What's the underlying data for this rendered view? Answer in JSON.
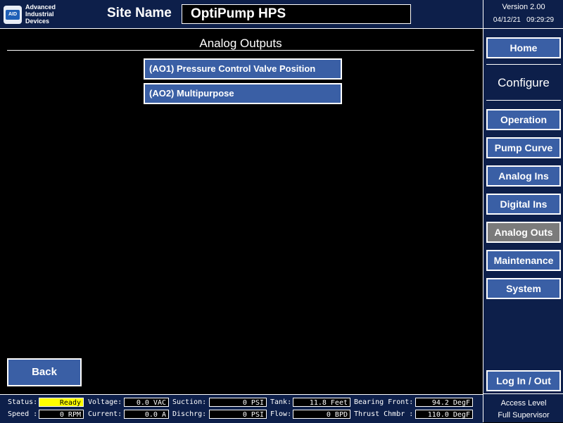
{
  "header": {
    "logo_badge": "AID",
    "logo_line1": "Advanced",
    "logo_line2": "Industrial",
    "logo_line3": "Devices",
    "site_label": "Site Name",
    "site_name": "OptiPump HPS"
  },
  "sidebar": {
    "version": "Version 2.00",
    "date": "04/12/21",
    "time": "09:29:29",
    "home": "Home",
    "configure": "Configure",
    "items": [
      {
        "label": "Operation"
      },
      {
        "label": "Pump Curve"
      },
      {
        "label": "Analog Ins"
      },
      {
        "label": "Digital Ins"
      },
      {
        "label": "Analog Outs",
        "active": true
      },
      {
        "label": "Maintenance"
      },
      {
        "label": "System"
      }
    ],
    "login": "Log In / Out",
    "access_label": "Access Level",
    "access_value": "Full Supervisor"
  },
  "main": {
    "title": "Analog Outputs",
    "outputs": [
      "(AO1) Pressure Control Valve Position",
      "(AO2) Multipurpose"
    ],
    "back": "Back"
  },
  "status_bar": {
    "status_label": "Status:",
    "status_value": "Ready",
    "speed_label": "Speed :",
    "speed_value": "0 RPM",
    "voltage_label": "Voltage:",
    "voltage_value": "0.0 VAC",
    "current_label": "Current:",
    "current_value": "0.0 A",
    "suction_label": "Suction:",
    "suction_value": "0 PSI",
    "dischrg_label": "Dischrg:",
    "dischrg_value": "0 PSI",
    "tank_label": "Tank:",
    "tank_value": "11.8 Feet",
    "flow_label": "Flow:",
    "flow_value": "0 BPD",
    "bearing_label": "Bearing Front:",
    "bearing_value": "94.2 DegF",
    "thrust_label": "Thrust Chmbr :",
    "thrust_value": "110.0 DegF"
  },
  "colors": {
    "panel_navy": "#0d1f4a",
    "button_blue": "#3a5fa5",
    "active_gray": "#7b7b7b",
    "ready_yellow": "#ffff00"
  }
}
